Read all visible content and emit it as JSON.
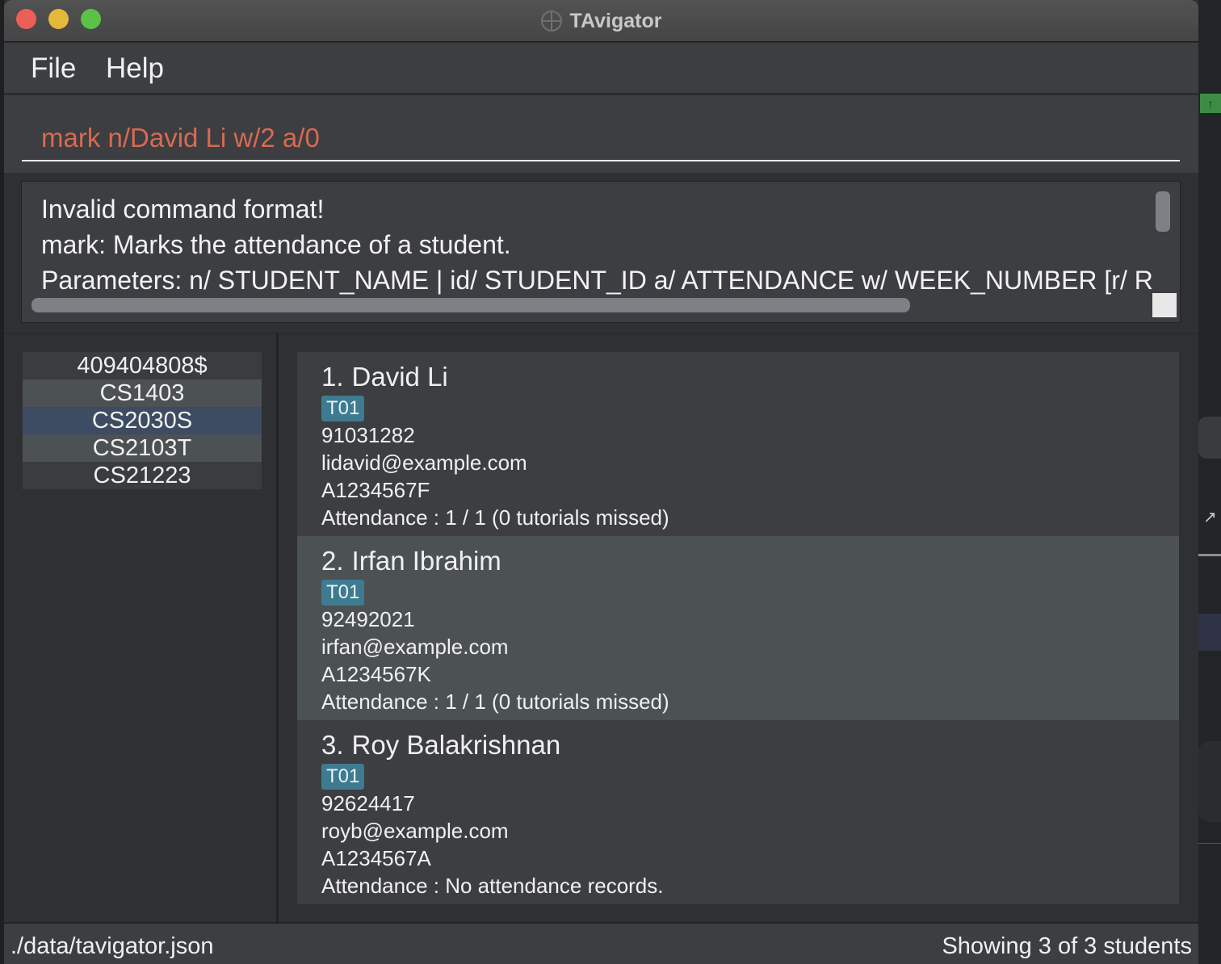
{
  "window": {
    "title": "TAvigator",
    "icon": "compass-icon"
  },
  "menu": {
    "file": "File",
    "help": "Help"
  },
  "command": {
    "value": "mark n/David Li w/2 a/0",
    "color": "#d86a50"
  },
  "result": {
    "lines": [
      "Invalid command format!",
      "mark: Marks the attendance of a student.",
      "Parameters: n/ STUDENT_NAME | id/ STUDENT_ID a/ ATTENDANCE w/ WEEK_NUMBER [r/ RE"
    ]
  },
  "courses": [
    {
      "label": "409404808$"
    },
    {
      "label": "CS1403"
    },
    {
      "label": "CS2030S"
    },
    {
      "label": "CS2103T"
    },
    {
      "label": "CS21223"
    }
  ],
  "students": [
    {
      "index": "1.",
      "name": "David Li",
      "tag": "T01",
      "phone": "91031282",
      "email": "lidavid@example.com",
      "student_id": "A1234567F",
      "attendance": "Attendance : 1 / 1 (0 tutorials missed)"
    },
    {
      "index": "2.",
      "name": "Irfan Ibrahim",
      "tag": "T01",
      "phone": "92492021",
      "email": "irfan@example.com",
      "student_id": "A1234567K",
      "attendance": "Attendance : 1 / 1 (0 tutorials missed)"
    },
    {
      "index": "3.",
      "name": "Roy Balakrishnan",
      "tag": "T01",
      "phone": "92624417",
      "email": "royb@example.com",
      "student_id": "A1234567A",
      "attendance": "Attendance : No attendance records."
    }
  ],
  "status": {
    "path": "./data/tavigator.json",
    "count": "Showing 3 of 3 students"
  },
  "colors": {
    "tag": "#3e7b91",
    "selected_course": "#3d4b63",
    "selected_card": "#4c5154"
  }
}
